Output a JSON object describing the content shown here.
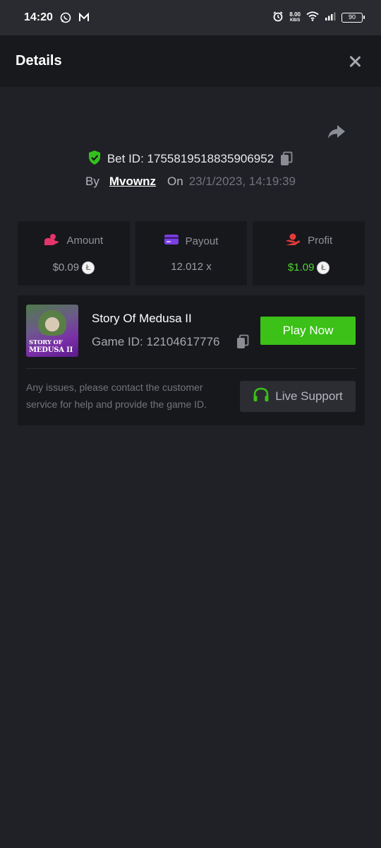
{
  "status_bar": {
    "time": "14:20",
    "net_speed_value": "8.00",
    "net_speed_unit": "KB/S",
    "battery": "90"
  },
  "header": {
    "title": "Details"
  },
  "bet": {
    "id_label": "Bet ID:",
    "id_value": "1755819518835906952",
    "by_label": "By",
    "username": "Mvownz",
    "on_label": "On",
    "date": "23/1/2023, 14:19:39"
  },
  "stats": {
    "amount": {
      "label": "Amount",
      "value": "$0.09",
      "icon": "wallet-coins-icon",
      "color": "#e2356a"
    },
    "payout": {
      "label": "Payout",
      "value": "12.012 x",
      "icon": "card-icon",
      "color": "#7b3fe4"
    },
    "profit": {
      "label": "Profit",
      "value": "$1.09",
      "icon": "hand-money-icon",
      "color": "#e33a3a",
      "value_color": "#4fd12f"
    },
    "coin_symbol": "Ł"
  },
  "game": {
    "name": "Story Of Medusa II",
    "id_label": "Game ID:",
    "id_value": "12104617776",
    "thumb_title_line1": "STORY OF",
    "thumb_title_line2": "MEDUSA II",
    "play_label": "Play Now",
    "help_text": "Any issues, please contact the customer service for help and provide the game ID.",
    "support_label": "Live Support"
  },
  "colors": {
    "background": "#202126",
    "card": "#17181c",
    "accent_green": "#3bc117",
    "shield_green": "#33c11c"
  }
}
